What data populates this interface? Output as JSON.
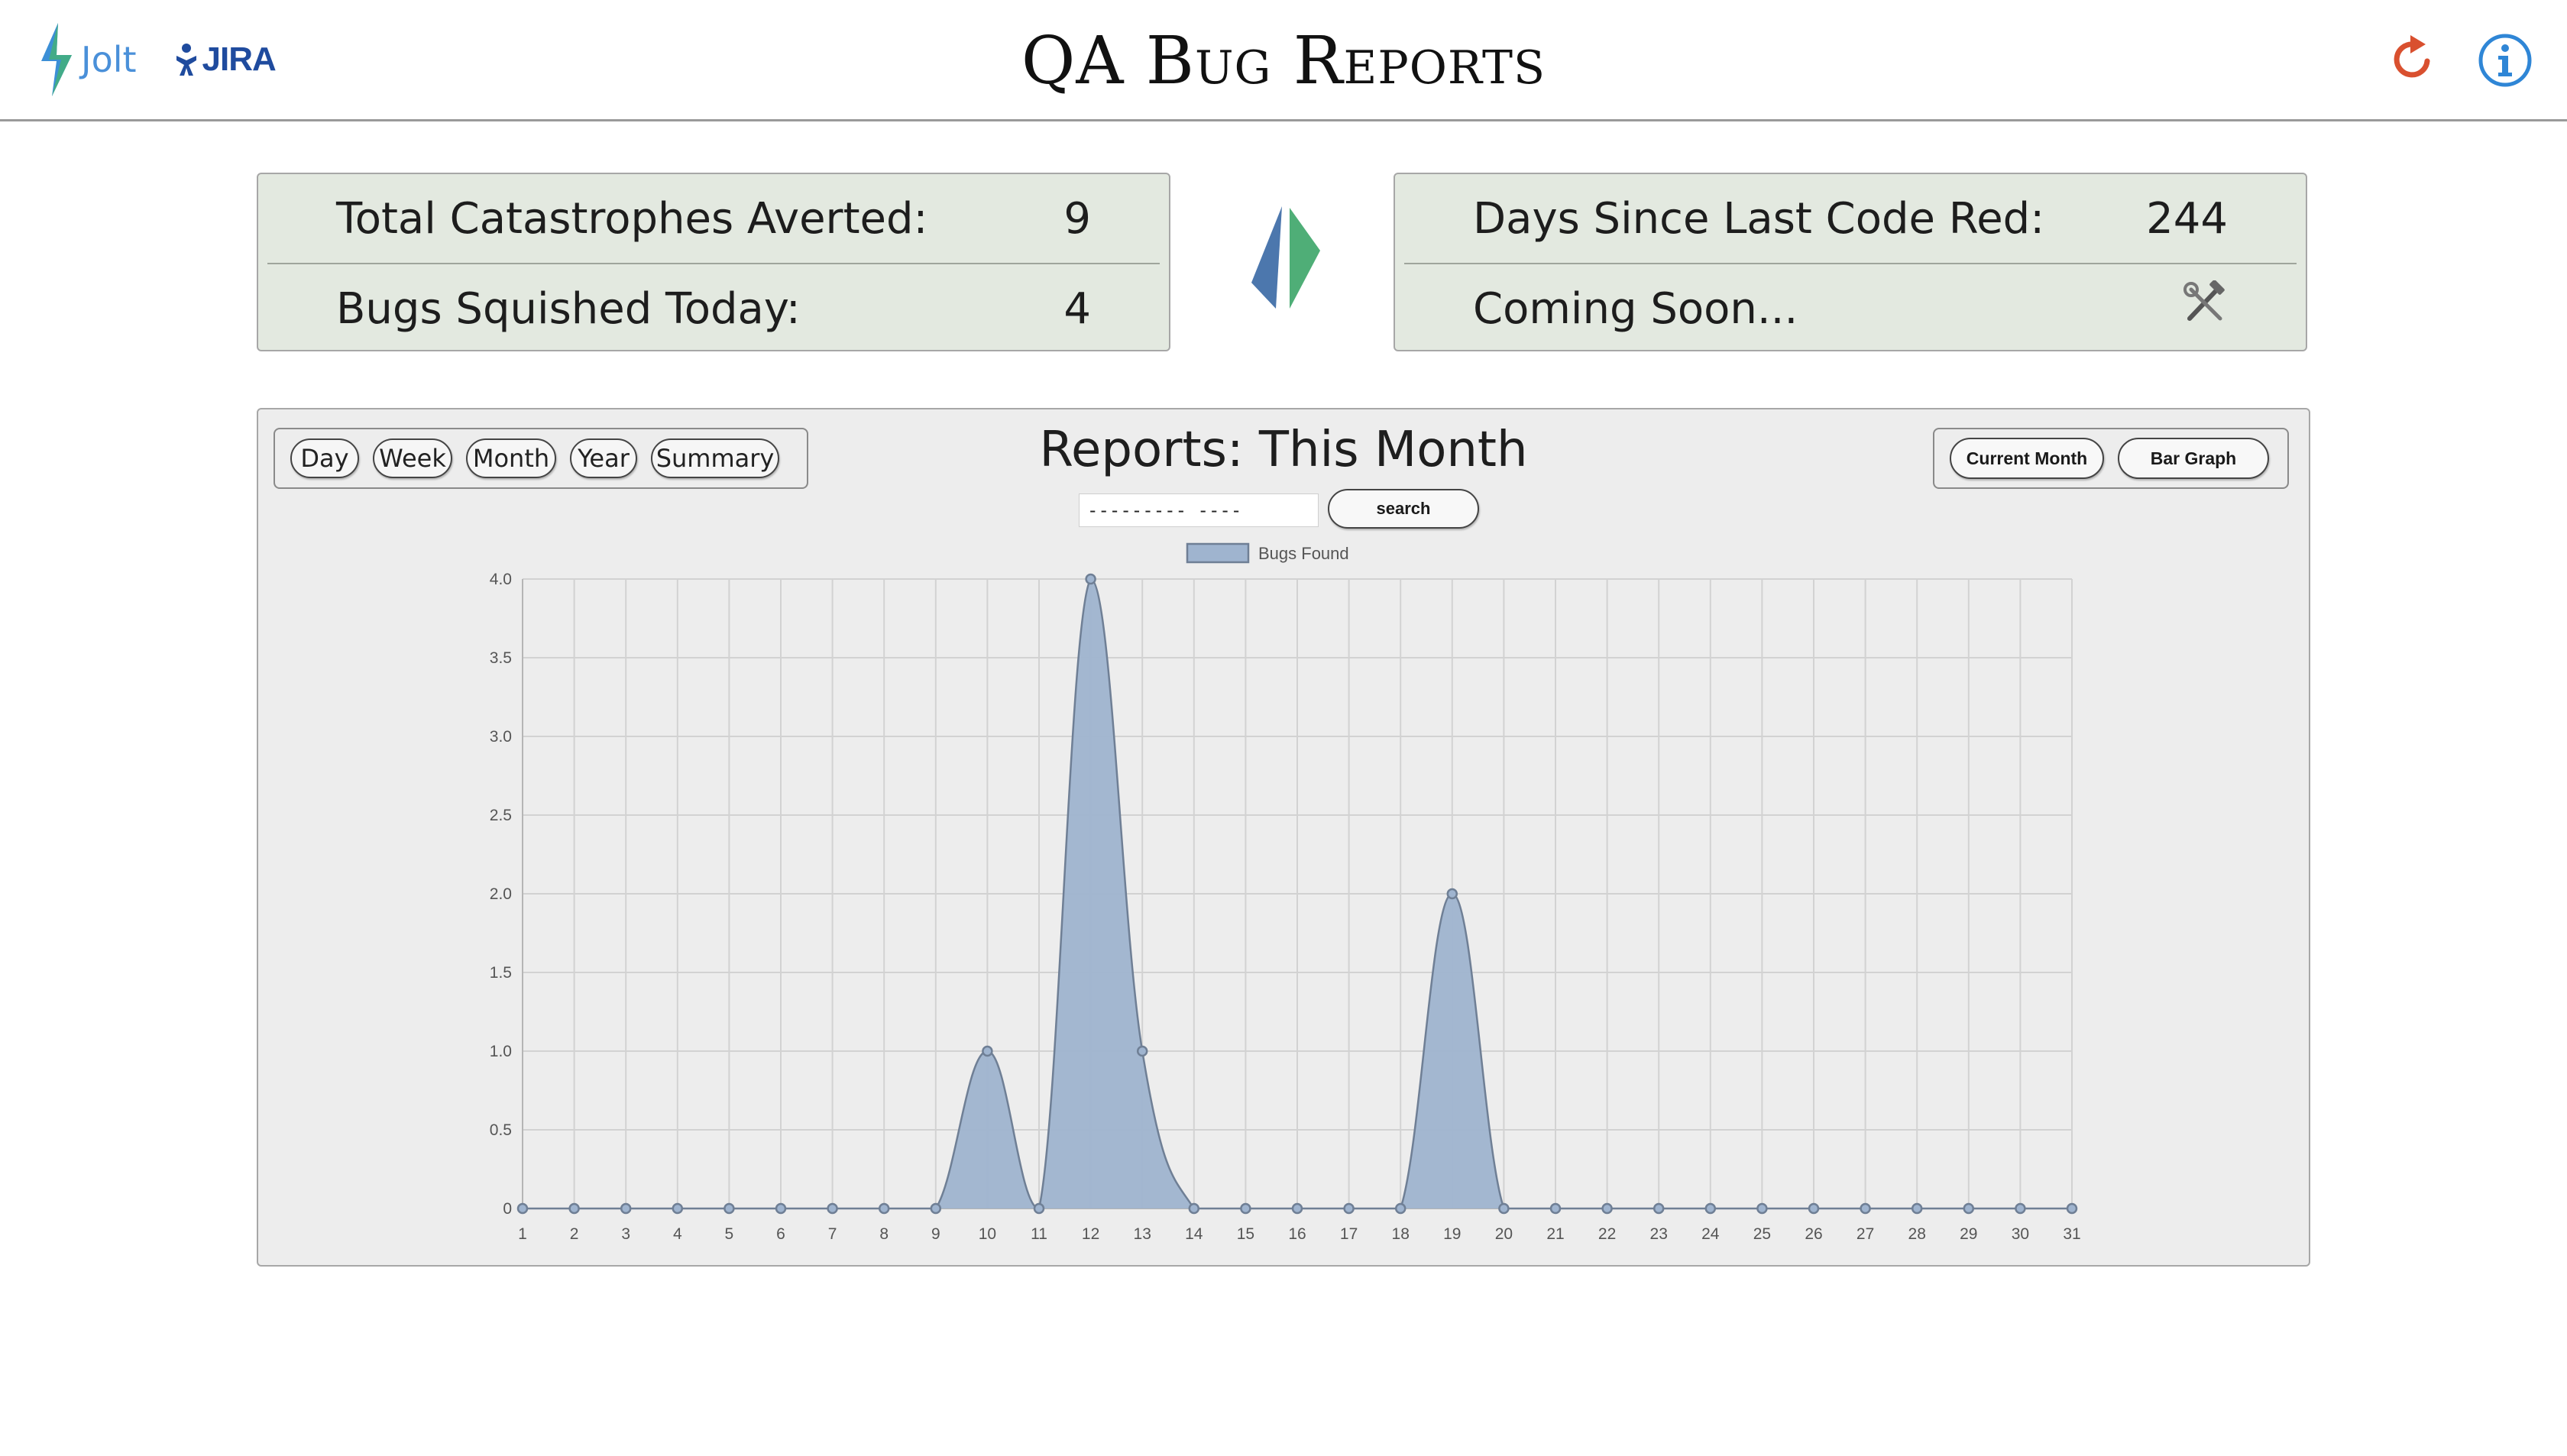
{
  "header": {
    "jolt_label": "Jolt",
    "jira_label": "JIRA",
    "title": "QA Bug Reports",
    "refresh_icon": "refresh-icon",
    "info_icon": "info-icon"
  },
  "stats_left": {
    "row1_label": "Total Catastrophes Averted:",
    "row1_value": "9",
    "row2_label": "Bugs Squished Today:",
    "row2_value": "4"
  },
  "stats_right": {
    "row1_label": "Days Since Last Code Red:",
    "row1_value": "244",
    "row2_label": "Coming Soon...",
    "row2_icon": "tools-icon"
  },
  "chart_panel": {
    "range_buttons": [
      "Day",
      "Week",
      "Month",
      "Year",
      "Summary"
    ],
    "title": "Reports: This Month",
    "search_value": "--------- ----",
    "search_label": "search",
    "current_month_label": "Current Month",
    "bar_graph_label": "Bar Graph"
  },
  "colors": {
    "panel_green": "#e3e9e0",
    "area_fill": "#9fb4cf",
    "area_stroke": "#6f7f95",
    "accent_blue": "#4a90d9",
    "refresh_red": "#d9502f"
  },
  "chart_data": {
    "type": "area",
    "x": [
      1,
      2,
      3,
      4,
      5,
      6,
      7,
      8,
      9,
      10,
      11,
      12,
      13,
      14,
      15,
      16,
      17,
      18,
      19,
      20,
      21,
      22,
      23,
      24,
      25,
      26,
      27,
      28,
      29,
      30,
      31
    ],
    "series": [
      {
        "name": "Bugs Found",
        "values": [
          0,
          0,
          0,
          0,
          0,
          0,
          0,
          0,
          0,
          1,
          0,
          4,
          1,
          0,
          0,
          0,
          0,
          0,
          2,
          0,
          0,
          0,
          0,
          0,
          0,
          0,
          0,
          0,
          0,
          0,
          0
        ]
      }
    ],
    "title": "Reports: This Month",
    "xlabel": "",
    "ylabel": "",
    "ylim": [
      0,
      4
    ],
    "yticks": [
      "0",
      "0.5",
      "1.0",
      "1.5",
      "2.0",
      "2.5",
      "3.0",
      "3.5",
      "4.0"
    ],
    "grid": true,
    "legend": "top"
  }
}
